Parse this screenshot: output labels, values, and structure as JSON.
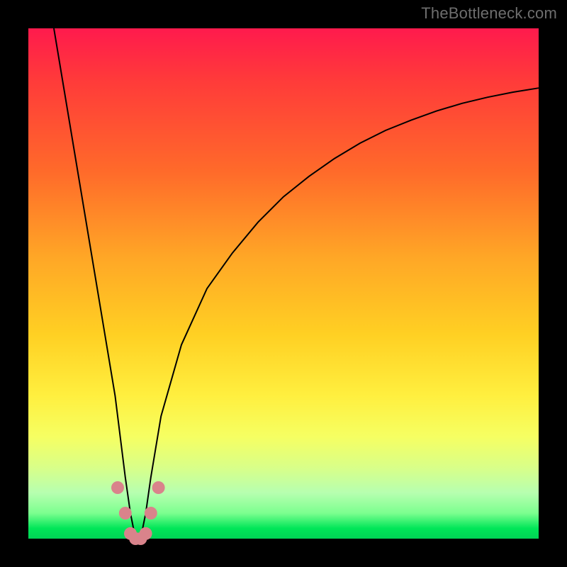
{
  "watermark": "TheBottleneck.com",
  "chart_data": {
    "type": "line",
    "title": "",
    "xlabel": "",
    "ylabel": "",
    "xlim": [
      0,
      100
    ],
    "ylim": [
      0,
      100
    ],
    "grid": false,
    "background_gradient": {
      "top": "#ff1a4d",
      "bottom": "#00d455",
      "stops": [
        "red",
        "orange",
        "yellow",
        "light-green",
        "green"
      ]
    },
    "series": [
      {
        "name": "bottleneck-curve",
        "x": [
          5,
          7,
          9,
          11,
          13,
          15,
          17,
          18,
          19,
          20,
          21,
          22,
          23,
          24,
          26,
          30,
          35,
          40,
          45,
          50,
          55,
          60,
          65,
          70,
          75,
          80,
          85,
          90,
          95,
          100
        ],
        "values": [
          100,
          88,
          76,
          64,
          52,
          40,
          28,
          20,
          12,
          5,
          0,
          0,
          5,
          12,
          24,
          38,
          49,
          56,
          62,
          67,
          71,
          74.5,
          77.5,
          80,
          82,
          83.8,
          85.3,
          86.5,
          87.5,
          88.3
        ]
      }
    ],
    "markers": {
      "name": "highlight-markers",
      "color": "#d9838b",
      "points_x": [
        17.5,
        19,
        20,
        21,
        22,
        23,
        24,
        25.5
      ],
      "points_y": [
        10,
        5,
        1,
        0,
        0,
        1,
        5,
        10
      ]
    },
    "annotations": []
  }
}
